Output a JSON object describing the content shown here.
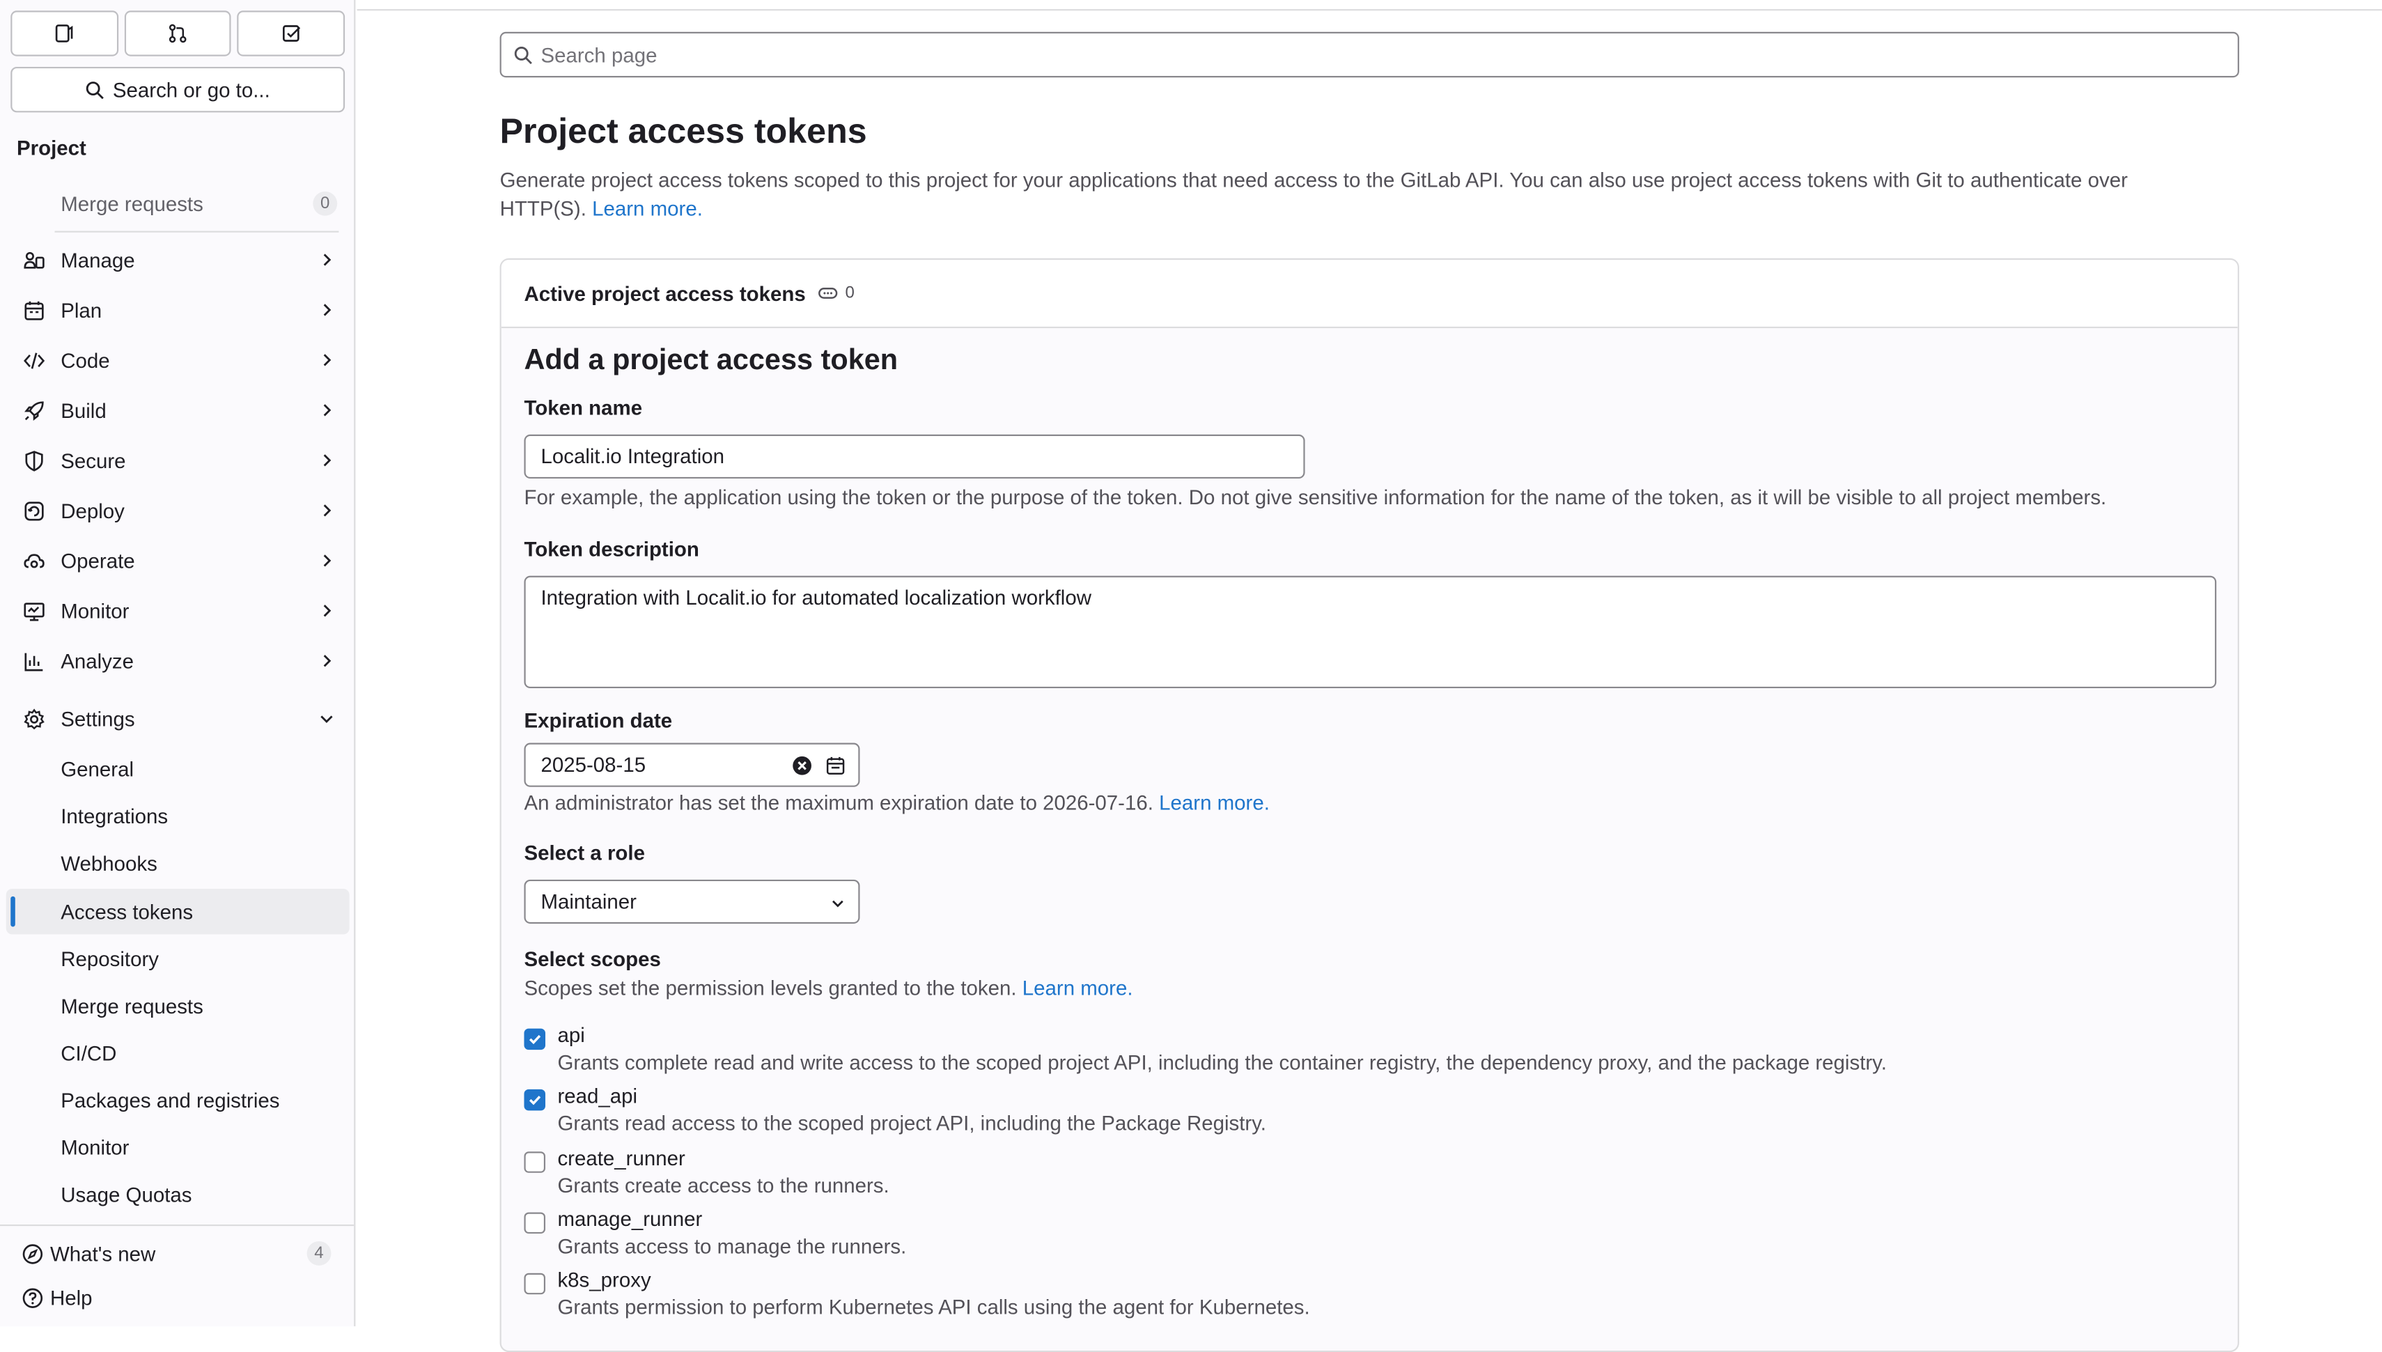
{
  "sidebar": {
    "search_label": "Search or go to...",
    "heading": "Project",
    "merge_requests_top": {
      "label": "Merge requests",
      "count": "0"
    },
    "sections": [
      {
        "label": "Manage",
        "icon": "users-icon"
      },
      {
        "label": "Plan",
        "icon": "calendar-icon"
      },
      {
        "label": "Code",
        "icon": "code-icon"
      },
      {
        "label": "Build",
        "icon": "rocket-icon"
      },
      {
        "label": "Secure",
        "icon": "shield-icon"
      },
      {
        "label": "Deploy",
        "icon": "deploy-icon"
      },
      {
        "label": "Operate",
        "icon": "cloud-gear-icon"
      },
      {
        "label": "Monitor",
        "icon": "monitor-icon"
      },
      {
        "label": "Analyze",
        "icon": "chart-icon"
      },
      {
        "label": "Settings",
        "icon": "gear-icon"
      }
    ],
    "settings_items": [
      "General",
      "Integrations",
      "Webhooks",
      "Access tokens",
      "Repository",
      "Merge requests",
      "CI/CD",
      "Packages and registries",
      "Monitor",
      "Usage Quotas"
    ],
    "active_item": "Access tokens",
    "whats_new": {
      "label": "What's new",
      "count": "4"
    },
    "help": "Help"
  },
  "page": {
    "search_placeholder": "Search page",
    "title": "Project access tokens",
    "description": "Generate project access tokens scoped to this project for your applications that need access to the GitLab API. You can also use project access tokens with Git to authenticate over HTTP(S).",
    "learn_more": "Learn more."
  },
  "card": {
    "header": "Active project access tokens",
    "count": "0"
  },
  "form": {
    "title": "Add a project access token",
    "token_name_label": "Token name",
    "token_name_value": "Localit.io Integration",
    "token_name_help": "For example, the application using the token or the purpose of the token. Do not give sensitive information for the name of the token, as it will be visible to all project members.",
    "description_label": "Token description",
    "description_value": "Integration with Localit.io for automated localization workflow",
    "expiration_label": "Expiration date",
    "expiration_value": "2025-08-15",
    "expiration_help": "An administrator has set the maximum expiration date to 2026-07-16.",
    "expiration_learn_more": "Learn more.",
    "role_label": "Select a role",
    "role_value": "Maintainer",
    "scopes_label": "Select scopes",
    "scopes_help": "Scopes set the permission levels granted to the token.",
    "scopes_learn_more": "Learn more.",
    "scopes": [
      {
        "name": "api",
        "checked": true,
        "desc": "Grants complete read and write access to the scoped project API, including the container registry, the dependency proxy, and the package registry."
      },
      {
        "name": "read_api",
        "checked": true,
        "desc": "Grants read access to the scoped project API, including the Package Registry."
      },
      {
        "name": "create_runner",
        "checked": false,
        "desc": "Grants create access to the runners."
      },
      {
        "name": "manage_runner",
        "checked": false,
        "desc": "Grants access to manage the runners."
      },
      {
        "name": "k8s_proxy",
        "checked": false,
        "desc": "Grants permission to perform Kubernetes API calls using the agent for Kubernetes."
      }
    ]
  },
  "colors": {
    "link": "#1f75cb",
    "active_bar": "#1f75cb",
    "checkbox_checked": "#1f75cb"
  }
}
